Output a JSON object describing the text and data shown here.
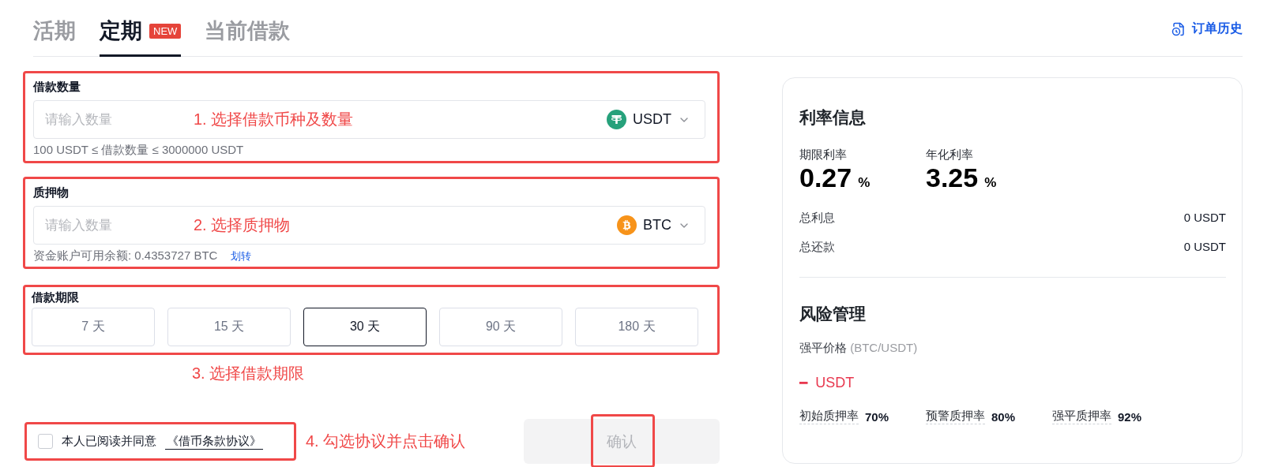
{
  "tabs": [
    {
      "label": "活期",
      "selected": false
    },
    {
      "label": "定期",
      "selected": true,
      "badge": "NEW"
    },
    {
      "label": "当前借款",
      "selected": false
    }
  ],
  "order_history": {
    "label": "订单历史"
  },
  "loan_amount": {
    "label": "借款数量",
    "placeholder": "请输入数量",
    "annotation": "1. 选择借款币种及数量",
    "coin": {
      "name": "USDT",
      "kind": "tether"
    },
    "hint": "100 USDT ≤ 借款数量 ≤  3000000 USDT"
  },
  "collateral": {
    "label": "质押物",
    "placeholder": "请输入数量",
    "annotation": "2. 选择质押物",
    "coin": {
      "name": "BTC",
      "kind": "bitcoin"
    },
    "balance": "资金账户可用余额: 0.4353727 BTC",
    "transfer_link": "划转"
  },
  "term": {
    "label": "借款期限",
    "annotation": "3. 选择借款期限",
    "options": [
      {
        "label": "7 天",
        "selected": false
      },
      {
        "label": "15 天",
        "selected": false
      },
      {
        "label": "30 天",
        "selected": true
      },
      {
        "label": "90 天",
        "selected": false
      },
      {
        "label": "180 天",
        "selected": false
      }
    ]
  },
  "agreement": {
    "checked": false,
    "text": "本人已阅读并同意",
    "link": "《借币条款协议》",
    "annotation": "4. 勾选协议并点击确认"
  },
  "confirm": {
    "label": "确认",
    "disabled": true
  },
  "rate_info": {
    "title": "利率信息",
    "rates": [
      {
        "label": "期限利率",
        "value": "0.27",
        "unit": "%"
      },
      {
        "label": "年化利率",
        "value": "3.25",
        "unit": "%"
      }
    ],
    "totals": [
      {
        "label": "总利息",
        "value": "0 USDT"
      },
      {
        "label": "总还款",
        "value": "0 USDT"
      }
    ]
  },
  "risk": {
    "title": "风险管理",
    "price_label": "强平价格",
    "pair": "(BTC/USDT)",
    "price": "━",
    "price_unit": "USDT",
    "ratios": [
      {
        "label": "初始质押率",
        "value": "70%"
      },
      {
        "label": "预警质押率",
        "value": "80%"
      },
      {
        "label": "强平质押率",
        "value": "92%"
      }
    ]
  }
}
